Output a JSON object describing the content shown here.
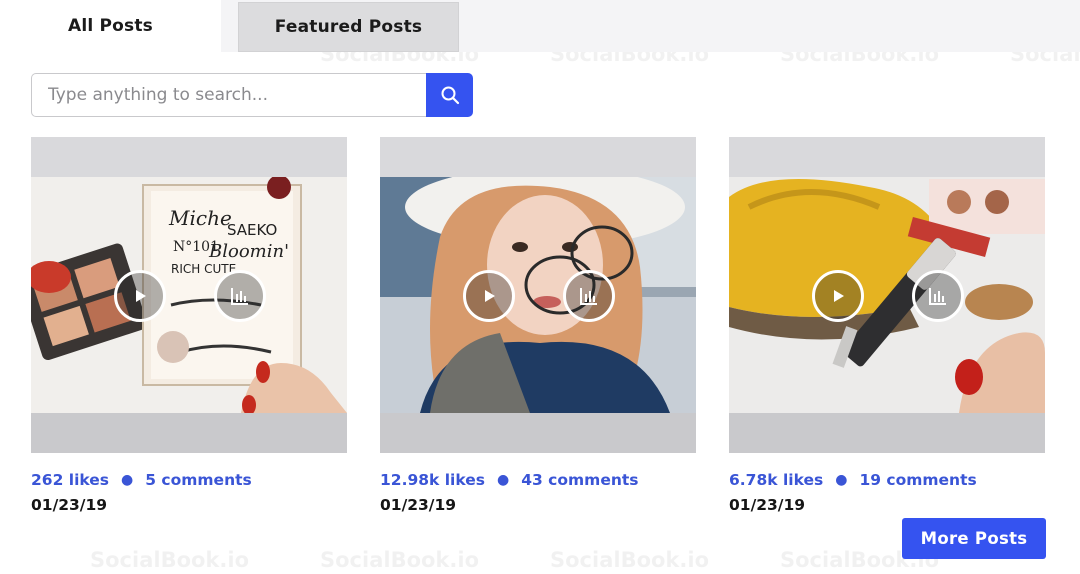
{
  "tabs": [
    {
      "label": "All Posts",
      "active": true
    },
    {
      "label": "Featured Posts",
      "active": false
    }
  ],
  "search": {
    "placeholder": "Type anything to search...",
    "value": "",
    "button_icon": "search-icon"
  },
  "watermark_text": "SocialBook.io",
  "posts": [
    {
      "likes": "262 likes",
      "comments": "5 comments",
      "date": "01/23/19"
    },
    {
      "likes": "12.98k likes",
      "comments": "43 comments",
      "date": "01/23/19"
    },
    {
      "likes": "6.78k likes",
      "comments": "19 comments",
      "date": "01/23/19"
    }
  ],
  "more_button": {
    "label": "More Posts"
  },
  "colors": {
    "accent": "#3553f0",
    "link": "#3a55d6",
    "tab_inactive": "#dcdcde"
  }
}
